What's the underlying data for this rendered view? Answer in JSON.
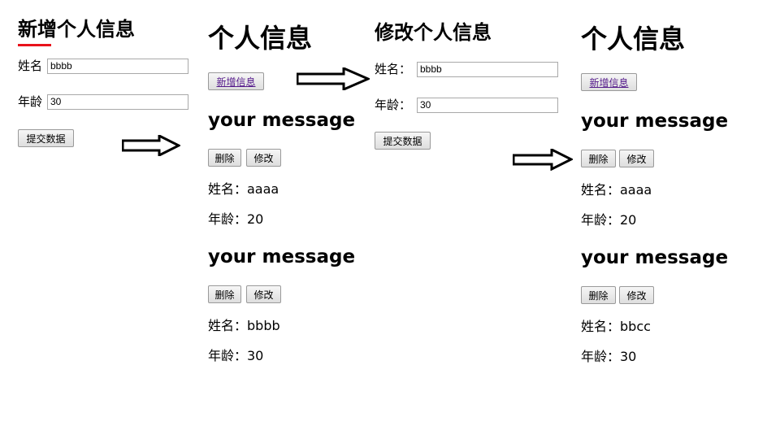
{
  "panel1": {
    "title": "新增个人信息",
    "name_label": "姓名",
    "name_value": "bbbb",
    "age_label": "年龄",
    "age_value": "30",
    "submit": "提交数据"
  },
  "panel2": {
    "title": "个人信息",
    "add_link": "新增信息",
    "records": [
      {
        "heading": "your message",
        "delete": "删除",
        "edit": "修改",
        "name": "姓名：aaaa",
        "age": "年龄：20"
      },
      {
        "heading": "your message",
        "delete": "删除",
        "edit": "修改",
        "name": "姓名：bbbb",
        "age": "年龄：30"
      }
    ]
  },
  "panel3": {
    "title": "修改个人信息",
    "name_label": "姓名：",
    "name_value": "bbbb",
    "age_label": "年龄：",
    "age_value": "30",
    "submit": "提交数据"
  },
  "panel4": {
    "title": "个人信息",
    "add_link": "新增信息",
    "records": [
      {
        "heading": "your message",
        "delete": "删除",
        "edit": "修改",
        "name": "姓名：aaaa",
        "age": "年龄：20"
      },
      {
        "heading": "your message",
        "delete": "删除",
        "edit": "修改",
        "name": "姓名：bbcc",
        "age": "年龄：30"
      }
    ]
  },
  "colors": {
    "accent_underline": "#e8121b",
    "link": "#551a8b"
  },
  "icons": [
    "right-arrow-icon"
  ]
}
